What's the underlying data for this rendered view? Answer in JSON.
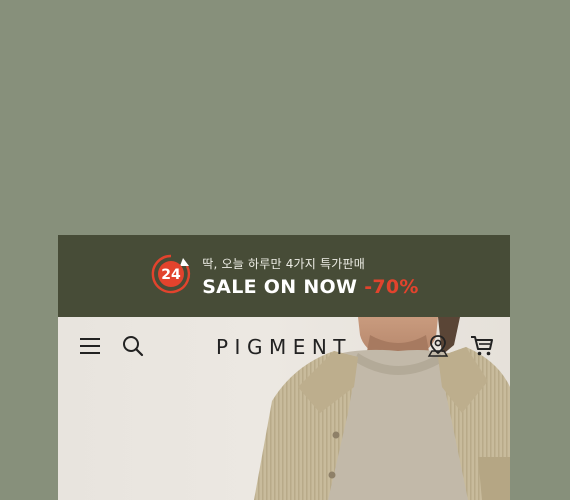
{
  "promo": {
    "badge_number": "24",
    "subtitle": "딱, 오늘 하루만 4가지 특가판매",
    "headline": "SALE ON NOW",
    "discount": "-70%"
  },
  "header": {
    "logo": "PIGMENT",
    "icons": [
      "menu-icon",
      "search-icon",
      "location-icon",
      "cart-icon"
    ]
  },
  "colors": {
    "page_background": "#87907b",
    "promo_background": "#474c37",
    "accent_red": "#e2432d"
  }
}
